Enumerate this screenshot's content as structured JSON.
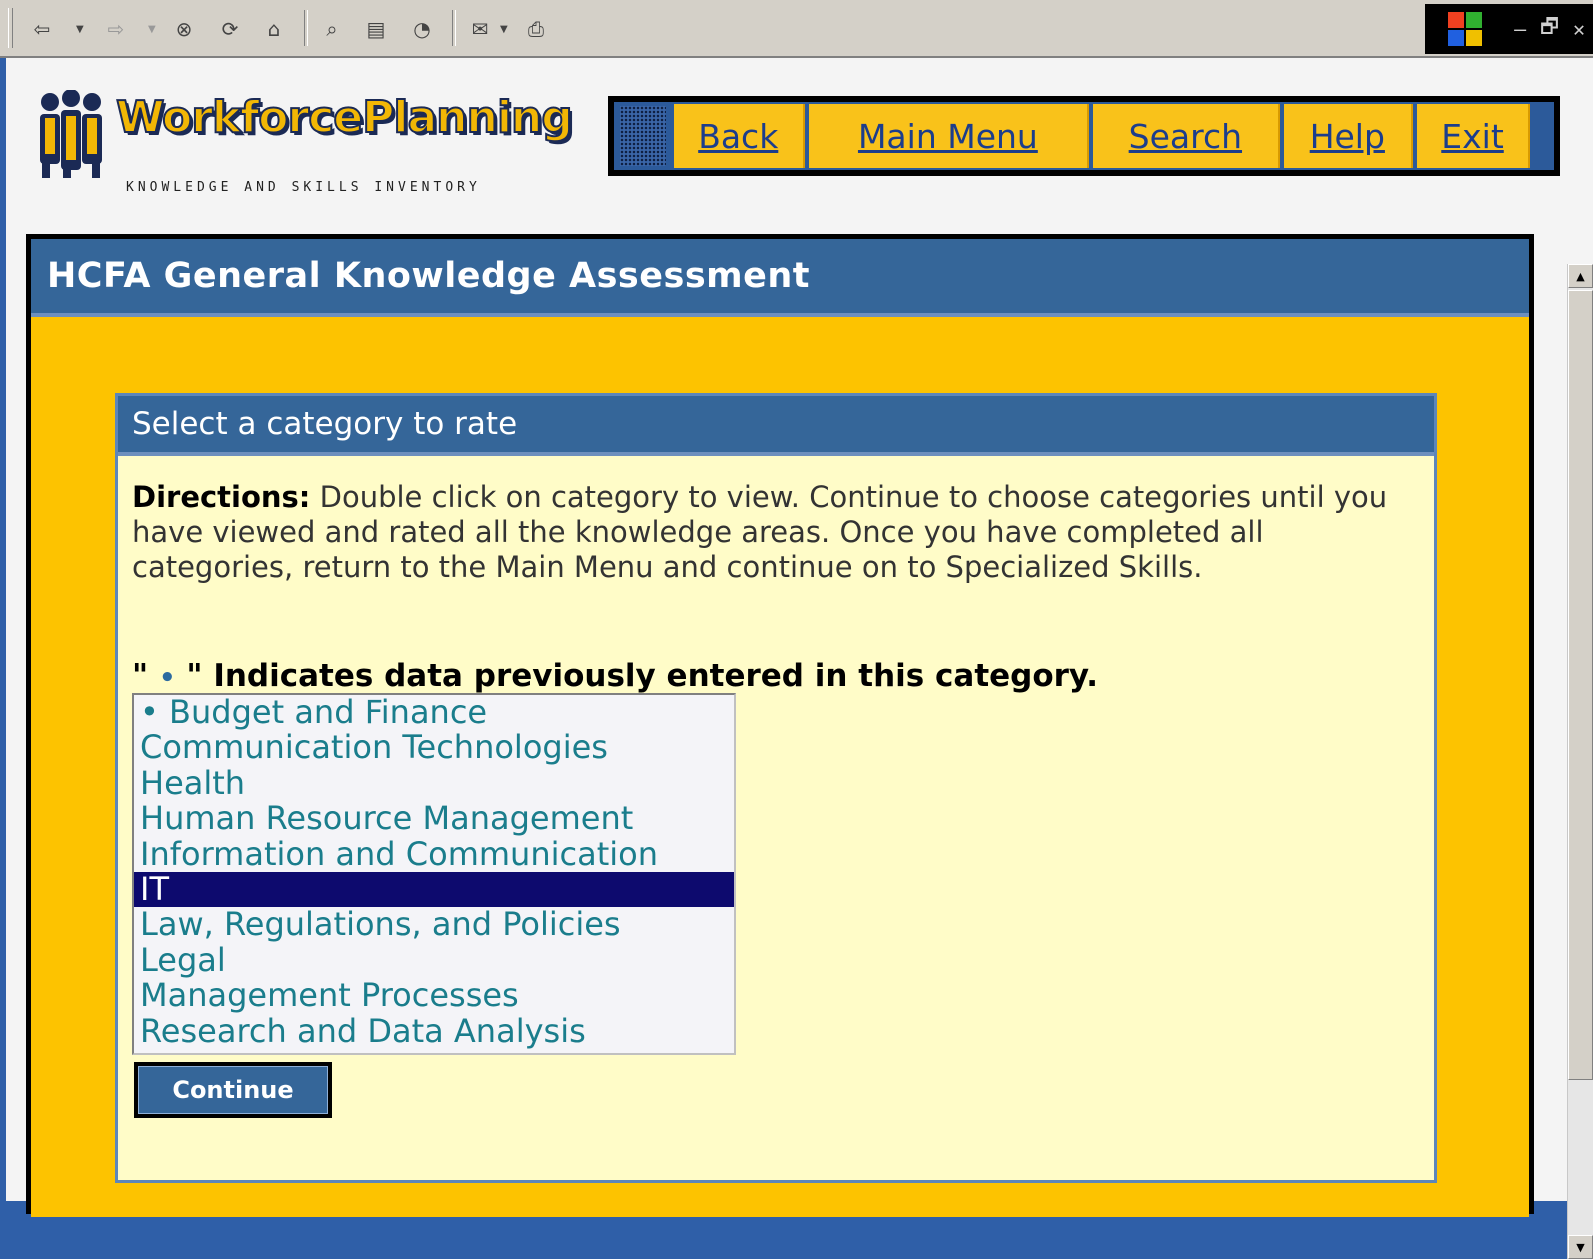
{
  "toolbar": {
    "icons": [
      "back-arrow-icon",
      "forward-arrow-icon",
      "stop-icon",
      "refresh-icon",
      "home-icon",
      "search-icon",
      "favorites-icon",
      "history-icon",
      "mail-icon",
      "print-icon"
    ],
    "window_controls": [
      "–",
      "🗗",
      "✕"
    ]
  },
  "logo": {
    "title": "WorkforcePlanning",
    "subtitle": "KNOWLEDGE AND SKILLS INVENTORY"
  },
  "nav": {
    "items": [
      {
        "label": "Back"
      },
      {
        "label": "Main Menu"
      },
      {
        "label": "Search"
      },
      {
        "label": "Help"
      },
      {
        "label": "Exit"
      }
    ]
  },
  "panel": {
    "title": "HCFA General Knowledge Assessment"
  },
  "selector": {
    "title": "Select a category to rate",
    "directions_label": "Directions:",
    "directions_text": " Double click on category to view. Continue to choose categories until you have viewed and rated all the knowledge areas. Once you have completed all categories, return to the Main Menu and continue on to Specialized Skills.",
    "indicator_open": "\" ",
    "indicator_dot": "•",
    "indicator_text": " \" Indicates data previously entered in this category.",
    "categories": [
      {
        "label": "• Budget and Finance"
      },
      {
        "label": "Communication Technologies"
      },
      {
        "label": "Health"
      },
      {
        "label": "Human Resource Management"
      },
      {
        "label": "Information and Communication"
      },
      {
        "label": "IT"
      },
      {
        "label": "Law, Regulations, and Policies"
      },
      {
        "label": "Legal"
      },
      {
        "label": "Management Processes"
      },
      {
        "label": "Research and Data Analysis"
      }
    ],
    "selected_category": "IT",
    "continue_label": "Continue"
  },
  "colors": {
    "header_blue": "#356699",
    "panel_gold": "#fdc300",
    "inner_bg": "#fffcc8",
    "list_text": "#1a7d8c",
    "selected_bg": "#0d0a6e"
  }
}
